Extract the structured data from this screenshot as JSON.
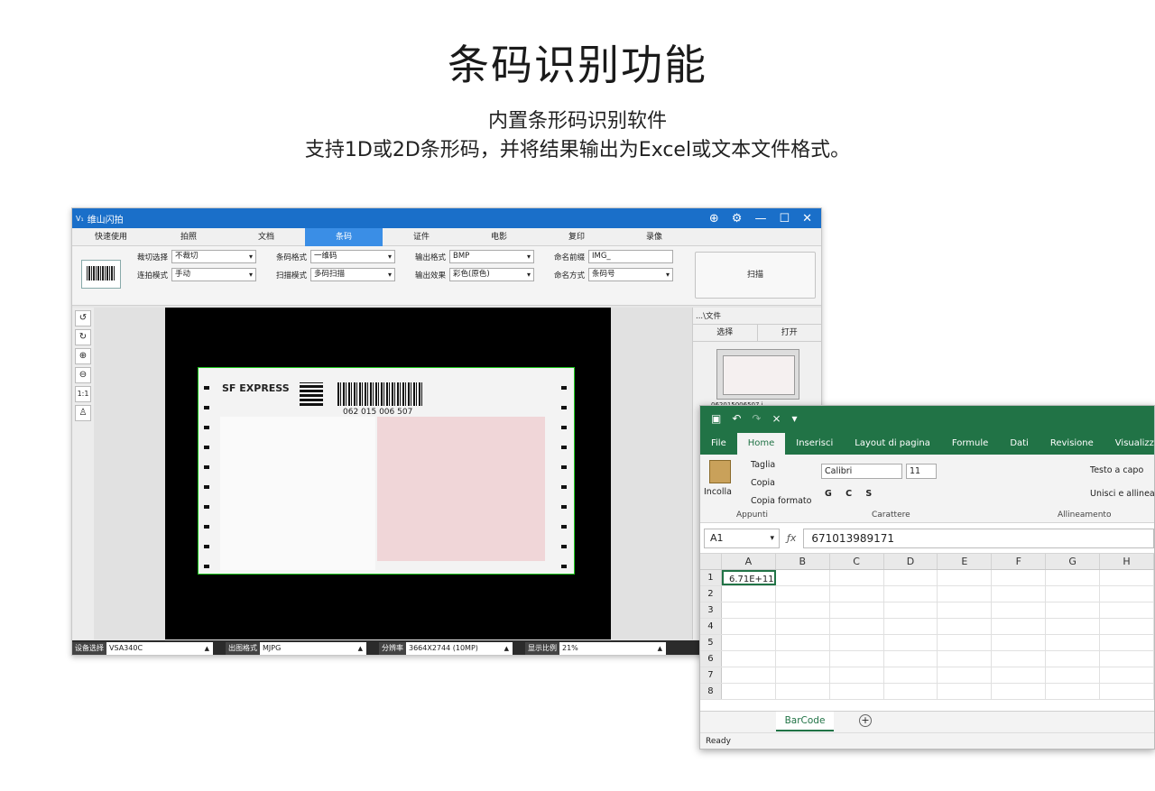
{
  "heading": {
    "title": "条码识别功能",
    "line1": "内置条形码识别软件",
    "line2": "支持1D或2D条形码，并将结果输出为Excel或文本文件格式。"
  },
  "scanner": {
    "app_title": "维山闪拍",
    "logo": "V₁",
    "tabs": [
      "快速使用",
      "拍照",
      "文档",
      "条码",
      "证件",
      "电影",
      "复印",
      "录像"
    ],
    "active_tab_index": 3,
    "fields": {
      "crop_label": "裁切选择",
      "crop_value": "不裁切",
      "shoot_label": "连拍模式",
      "shoot_value": "手动",
      "bc_format_label": "条码格式",
      "bc_format_value": "一维码",
      "scan_mode_label": "扫描模式",
      "scan_mode_value": "多码扫描",
      "out_format_label": "输出格式",
      "out_format_value": "BMP",
      "out_effect_label": "输出效果",
      "out_effect_value": "彩色(原色)",
      "prefix_label": "命名前缀",
      "prefix_value": "IMG_",
      "naming_label": "命名方式",
      "naming_value": "条码号"
    },
    "scan_button": "扫描",
    "tools": [
      "↺",
      "↻",
      "⊕",
      "⊖",
      "1:1",
      "♙"
    ],
    "path": "...\\文件",
    "select_btn": "选择",
    "open_btn": "打开",
    "thumb_caption": "062015006507.j",
    "doc": {
      "brand": "SF EXPRESS",
      "tracking": "062 015 006 507"
    },
    "status": {
      "device_label": "设备选择",
      "device_value": "VSA340C",
      "format_label": "出图格式",
      "format_value": "MJPG",
      "resolution_label": "分辨率",
      "resolution_value": "3664X2744 (10MP)",
      "ratio_label": "显示比例",
      "ratio_value": "21%"
    }
  },
  "excel": {
    "tabs": [
      "File",
      "Home",
      "Inserisci",
      "Layout di pagina",
      "Formule",
      "Dati",
      "Revisione",
      "Visualizza"
    ],
    "ribbon": {
      "paste": "Incolla",
      "cut": "Taglia",
      "copy": "Copia",
      "format_painter": "Copia formato",
      "clipboard": "Appunti",
      "font": "Calibri",
      "font_size": "11",
      "font_group": "Carattere",
      "wrap": "Testo a capo",
      "merge": "Unisci e allinea a",
      "align_group": "Allineamento"
    },
    "name_box": "A1",
    "formula_value": "671013989171",
    "columns": [
      "A",
      "B",
      "C",
      "D",
      "E",
      "F",
      "G",
      "H"
    ],
    "rows": [
      "1",
      "2",
      "3",
      "4",
      "5",
      "6",
      "7",
      "8"
    ],
    "a1": "6.71E+11",
    "sheet": "BarCode",
    "status": "Ready",
    "accent": "#217346"
  }
}
